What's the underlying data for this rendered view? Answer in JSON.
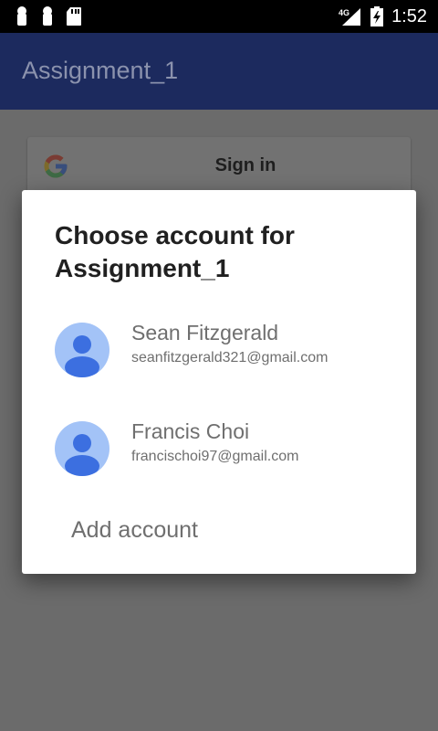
{
  "status_bar": {
    "time": "1:52",
    "network": "4G",
    "icons": [
      "notification-icon",
      "notification-icon",
      "sd-card-icon",
      "signal-icon",
      "battery-icon"
    ]
  },
  "app_bar": {
    "title": "Assignment_1"
  },
  "signin_button": {
    "label": "Sign in",
    "icon": "google-logo"
  },
  "dialog": {
    "title": "Choose account for Assignment_1",
    "accounts": [
      {
        "name": "Sean Fitzgerald",
        "email": "seanfitzgerald321@gmail.com"
      },
      {
        "name": "Francis Choi",
        "email": "francischoi97@gmail.com"
      }
    ],
    "add_account_label": "Add account"
  },
  "colors": {
    "app_bar": "#1c2a5e",
    "scrim_background": "#6b6b6b",
    "avatar_bg": "#a3c3f7",
    "avatar_fg": "#3c6fe0"
  }
}
